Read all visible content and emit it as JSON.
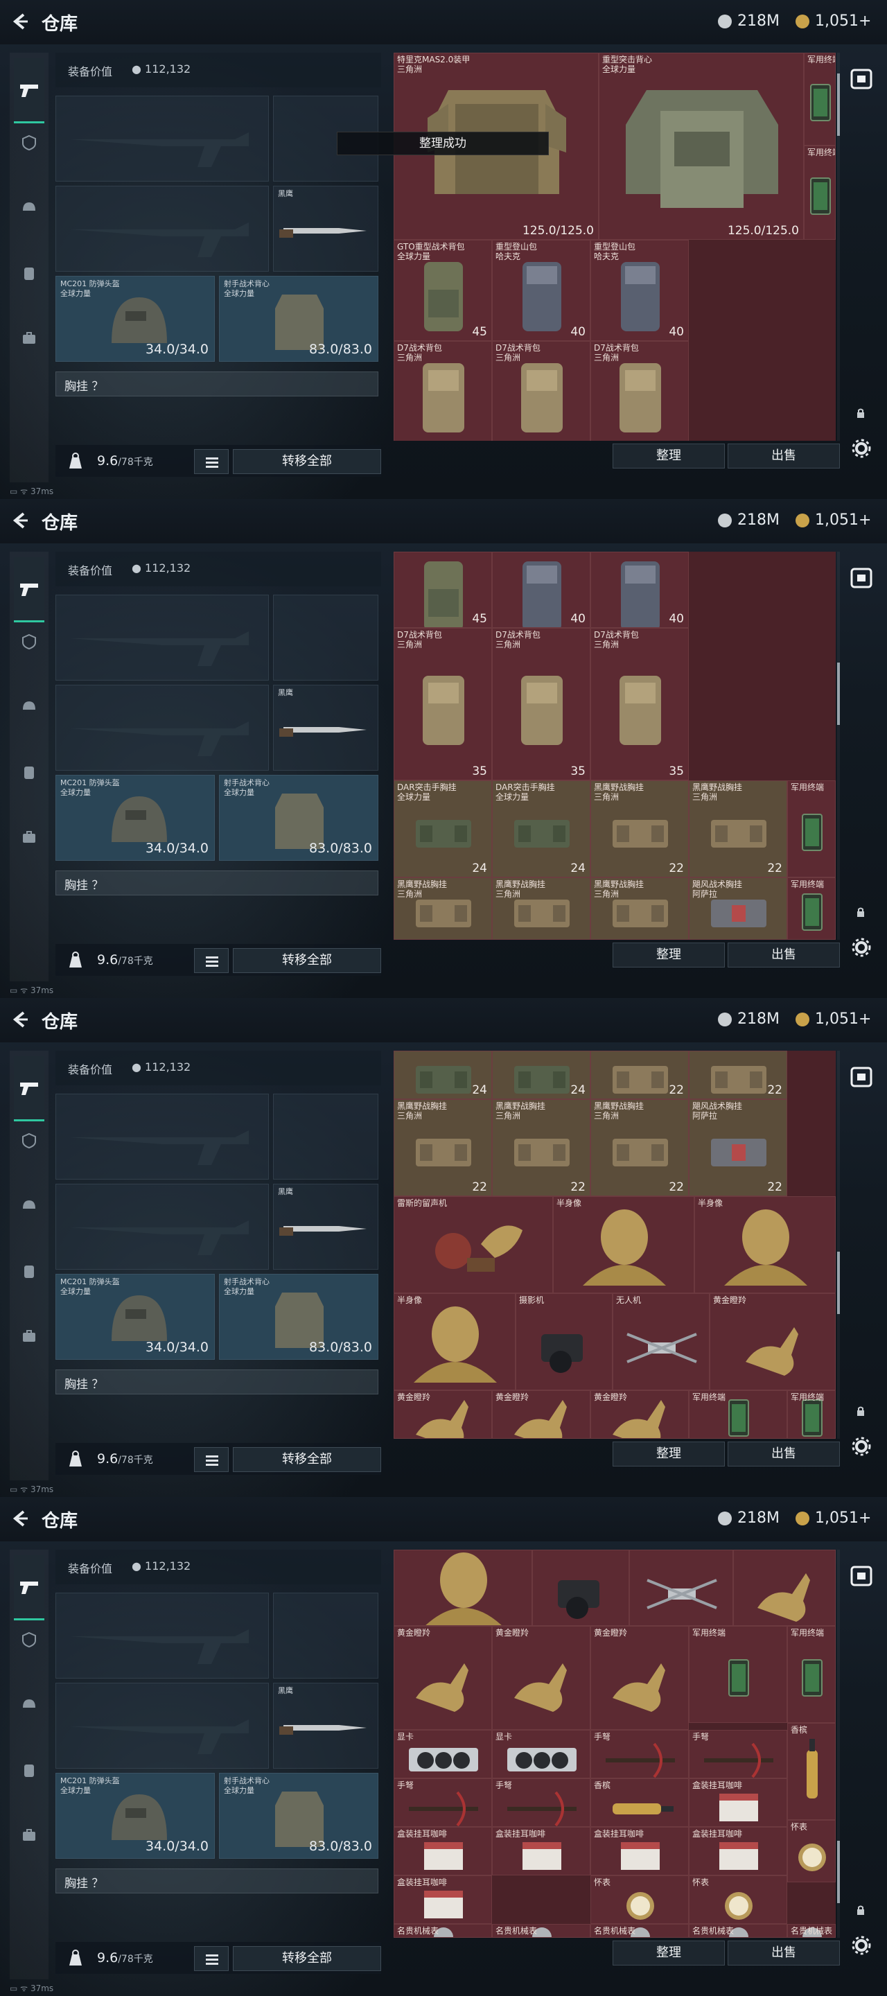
{
  "header": {
    "title": "仓库",
    "silver": "218M",
    "gold": "1,051+"
  },
  "panel": {
    "value_label": "装备价值",
    "value": "112,132",
    "chest_label": "胸挂 ？",
    "weight": "9.6",
    "weight_max": "/78千克",
    "transfer_label": "转移全部"
  },
  "slots": {
    "knife": "黑鹰",
    "helmet_name": "MC201 防弹头盔\n全球力量",
    "helmet_dur": "34.0/34.0",
    "vest_name": "射手战术背心\n全球力量",
    "vest_dur": "83.0/83.0"
  },
  "buttons": {
    "sort": "整理",
    "sell": "出售"
  },
  "toast": "整理成功",
  "status": "37ms",
  "frames": [
    {
      "cells": [
        {
          "name": "特里克MAS2.0装甲\n三角洲",
          "val": "125.0/125.0",
          "kind": "armor"
        },
        {
          "name": "重型突击背心\n全球力量",
          "val": "125.0/125.0",
          "kind": "armor2"
        },
        {
          "name": "军用终端",
          "val": "",
          "kind": "terminal"
        },
        {
          "name": "军用终端",
          "val": "",
          "kind": "terminal"
        },
        {
          "name": "GTO重型战术背包\n全球力量",
          "val": "45",
          "kind": "pack"
        },
        {
          "name": "重型登山包\n哈夫克",
          "val": "40",
          "kind": "pack2"
        },
        {
          "name": "重型登山包\n哈夫克",
          "val": "40",
          "kind": "pack2"
        },
        {
          "name": "D7战术背包\n三角洲",
          "val": "",
          "kind": "pack3"
        },
        {
          "name": "D7战术背包\n三角洲",
          "val": "",
          "kind": "pack3"
        },
        {
          "name": "D7战术背包\n三角洲",
          "val": "",
          "kind": "pack3"
        }
      ]
    },
    {
      "cells": [
        {
          "name": "",
          "val": "45",
          "kind": "pack"
        },
        {
          "name": "",
          "val": "40",
          "kind": "pack2"
        },
        {
          "name": "",
          "val": "40",
          "kind": "pack2"
        },
        {
          "name": "D7战术背包\n三角洲",
          "val": "35",
          "kind": "pack3"
        },
        {
          "name": "D7战术背包\n三角洲",
          "val": "35",
          "kind": "pack3"
        },
        {
          "name": "D7战术背包\n三角洲",
          "val": "35",
          "kind": "pack3"
        },
        {
          "name": "DAR突击手胸挂\n全球力量",
          "val": "24",
          "kind": "rig"
        },
        {
          "name": "DAR突击手胸挂\n全球力量",
          "val": "24",
          "kind": "rig"
        },
        {
          "name": "黑鹰野战胸挂\n三角洲",
          "val": "22",
          "kind": "rig2"
        },
        {
          "name": "黑鹰野战胸挂\n三角洲",
          "val": "22",
          "kind": "rig2"
        },
        {
          "name": "军用终端",
          "val": "",
          "kind": "terminal"
        },
        {
          "name": "黑鹰野战胸挂\n三角洲",
          "val": "",
          "kind": "rig2"
        },
        {
          "name": "黑鹰野战胸挂\n三角洲",
          "val": "",
          "kind": "rig2"
        },
        {
          "name": "黑鹰野战胸挂\n三角洲",
          "val": "",
          "kind": "rig2"
        },
        {
          "name": "飓风战术胸挂\n阿萨拉",
          "val": "",
          "kind": "rig3"
        },
        {
          "name": "军用终端",
          "val": "",
          "kind": "terminal"
        }
      ]
    },
    {
      "cells": [
        {
          "name": "",
          "val": "24",
          "kind": "rig"
        },
        {
          "name": "",
          "val": "24",
          "kind": "rig"
        },
        {
          "name": "",
          "val": "22",
          "kind": "rig2"
        },
        {
          "name": "",
          "val": "22",
          "kind": "rig2"
        },
        {
          "name": "黑鹰野战胸挂\n三角洲",
          "val": "22",
          "kind": "rig2"
        },
        {
          "name": "黑鹰野战胸挂\n三角洲",
          "val": "22",
          "kind": "rig2"
        },
        {
          "name": "黑鹰野战胸挂\n三角洲",
          "val": "22",
          "kind": "rig2"
        },
        {
          "name": "飓风战术胸挂\n阿萨拉",
          "val": "22",
          "kind": "rig3"
        },
        {
          "name": "雷斯的留声机",
          "val": "",
          "kind": "phono"
        },
        {
          "name": "半身像",
          "val": "",
          "kind": "bust"
        },
        {
          "name": "半身像",
          "val": "",
          "kind": "bust"
        },
        {
          "name": "半身像",
          "val": "",
          "kind": "bust"
        },
        {
          "name": "摄影机",
          "val": "",
          "kind": "camera"
        },
        {
          "name": "无人机",
          "val": "",
          "kind": "drone"
        },
        {
          "name": "黄金瞪羚",
          "val": "",
          "kind": "gazelle"
        },
        {
          "name": "黄金瞪羚",
          "val": "",
          "kind": "gazelle"
        },
        {
          "name": "黄金瞪羚",
          "val": "",
          "kind": "gazelle"
        },
        {
          "name": "黄金瞪羚",
          "val": "",
          "kind": "gazelle"
        },
        {
          "name": "军用终端",
          "val": "",
          "kind": "terminal"
        },
        {
          "name": "军用终端",
          "val": "",
          "kind": "terminal"
        }
      ]
    },
    {
      "cells": [
        {
          "name": "",
          "val": "",
          "kind": "bust"
        },
        {
          "name": "",
          "val": "",
          "kind": "camera"
        },
        {
          "name": "",
          "val": "",
          "kind": "drone"
        },
        {
          "name": "",
          "val": "",
          "kind": "gazelle"
        },
        {
          "name": "黄金瞪羚",
          "val": "",
          "kind": "gazelle"
        },
        {
          "name": "黄金瞪羚",
          "val": "",
          "kind": "gazelle"
        },
        {
          "name": "黄金瞪羚",
          "val": "",
          "kind": "gazelle"
        },
        {
          "name": "军用终端",
          "val": "",
          "kind": "terminal"
        },
        {
          "name": "军用终端",
          "val": "",
          "kind": "terminal"
        },
        {
          "name": "显卡",
          "val": "",
          "kind": "gpu"
        },
        {
          "name": "显卡",
          "val": "",
          "kind": "gpu"
        },
        {
          "name": "手弩",
          "val": "",
          "kind": "xbow"
        },
        {
          "name": "手弩",
          "val": "",
          "kind": "xbow"
        },
        {
          "name": "香槟",
          "val": "",
          "kind": "bottle"
        },
        {
          "name": "手弩",
          "val": "",
          "kind": "xbow"
        },
        {
          "name": "手弩",
          "val": "",
          "kind": "xbow"
        },
        {
          "name": "香槟",
          "val": "",
          "kind": "bottle2"
        },
        {
          "name": "盒装挂耳咖啡",
          "val": "",
          "kind": "box"
        },
        {
          "name": "盒装挂耳咖啡",
          "val": "",
          "kind": "box"
        },
        {
          "name": "盒装挂耳咖啡",
          "val": "",
          "kind": "box"
        },
        {
          "name": "盒装挂耳咖啡",
          "val": "",
          "kind": "box"
        },
        {
          "name": "盒装挂耳咖啡",
          "val": "",
          "kind": "box"
        },
        {
          "name": "怀表",
          "val": "",
          "kind": "watch"
        },
        {
          "name": "怀表",
          "val": "",
          "kind": "watch"
        },
        {
          "name": "怀表",
          "val": "",
          "kind": "watch"
        },
        {
          "name": "盒装挂耳咖啡",
          "val": "",
          "kind": "box"
        },
        {
          "name": "名贵机械表",
          "val": "",
          "kind": "watch2"
        },
        {
          "name": "名贵机械表",
          "val": "",
          "kind": "watch2"
        },
        {
          "name": "名贵机械表",
          "val": "",
          "kind": "watch2"
        },
        {
          "name": "名贵机械表",
          "val": "",
          "kind": "watch2"
        },
        {
          "name": "名贵机械表",
          "val": "",
          "kind": "watch2"
        }
      ]
    }
  ],
  "colors": {
    "accent": "#2fc7a0",
    "grid_bg": "#5c2a32",
    "gold": "#c9a24a"
  }
}
